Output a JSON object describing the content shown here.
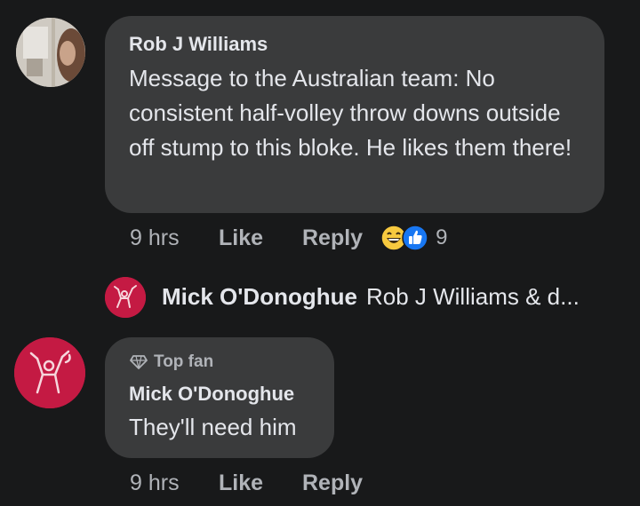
{
  "comments": [
    {
      "author": "Rob J Williams",
      "text": "Message to the Australian team: No consistent half-volley throw downs outside off stump to this bloke. He likes them there!",
      "time": "9 hrs",
      "like_label": "Like",
      "reply_label": "Reply",
      "reaction_icons": [
        "grinning-face-icon",
        "thumbs-up-icon"
      ],
      "reaction_count": "9"
    },
    {
      "badge": "Top fan",
      "author": "Mick O'Donoghue",
      "text": "They'll need him",
      "time": "9 hrs",
      "like_label": "Like",
      "reply_label": "Reply"
    }
  ],
  "reply_preview": {
    "author": "Mick O'Donoghue",
    "text": "Rob J Williams & d..."
  },
  "colors": {
    "background": "#18191a",
    "bubble": "#3a3b3c",
    "primary_text": "#e4e6eb",
    "secondary_text": "#b0b3b8",
    "like_blue": "#1877f2",
    "avatar_red": "#c41a43"
  }
}
